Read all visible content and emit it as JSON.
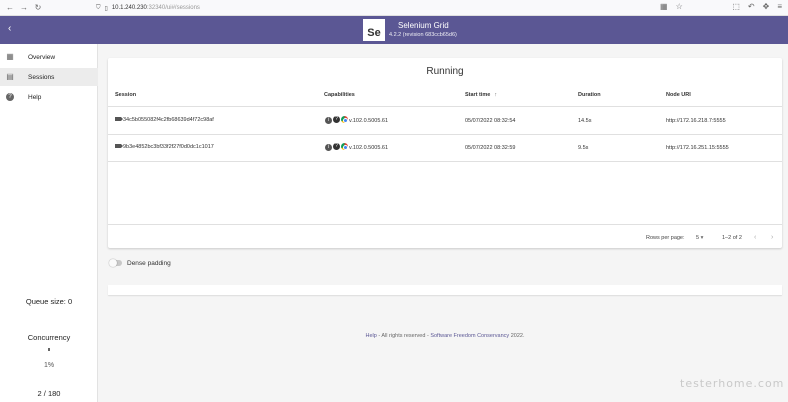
{
  "browser": {
    "url_host": "10.1.240.230",
    "url_rest": ":32340/ui#/sessions"
  },
  "header": {
    "logo_text": "Se",
    "title": "Selenium Grid",
    "subtitle": "4.2.2 (revision 683ccb65d6)"
  },
  "sidebar": {
    "items": [
      {
        "label": "Overview",
        "icon": "grid-icon"
      },
      {
        "label": "Sessions",
        "icon": "sessions-icon"
      },
      {
        "label": "Help",
        "icon": "help-icon"
      }
    ],
    "queue_size": "Queue size: 0",
    "concurrency_title": "Concurrency",
    "concurrency_fraction": 0.01,
    "concurrency_percent": "1%",
    "concurrency_count": "2 / 180"
  },
  "sessions": {
    "title": "Running",
    "columns": [
      "Session",
      "Capabilities",
      "Start time",
      "Duration",
      "Node URI"
    ],
    "rows": [
      {
        "id": "34c5b055082f4c2fb68639d4f72c98af",
        "version": "v.102.0.5005.61",
        "start": "05/07/2022 08:32:54",
        "duration": "14.5s",
        "node": "http://172.16.218.7:5555"
      },
      {
        "id": "9b3e4852bc3bf33f2f27f0d0dc1c1017",
        "version": "v.102.0.5005.61",
        "start": "05/07/2022 08:32:59",
        "duration": "9.5s",
        "node": "http://172.16.251.15:5555"
      }
    ],
    "rows_per_page_label": "Rows per page:",
    "rows_per_page_value": "5",
    "range": "1–2 of 2"
  },
  "dense_padding_label": "Dense padding",
  "footer": {
    "help": "Help",
    "middle": " - All rights reserved - ",
    "org": "Software Freedom Conservancy",
    "year": " 2022."
  },
  "watermark": "testerhome.com",
  "colors": {
    "accent": "#5b5794",
    "selenium_green": "#43b02a"
  }
}
